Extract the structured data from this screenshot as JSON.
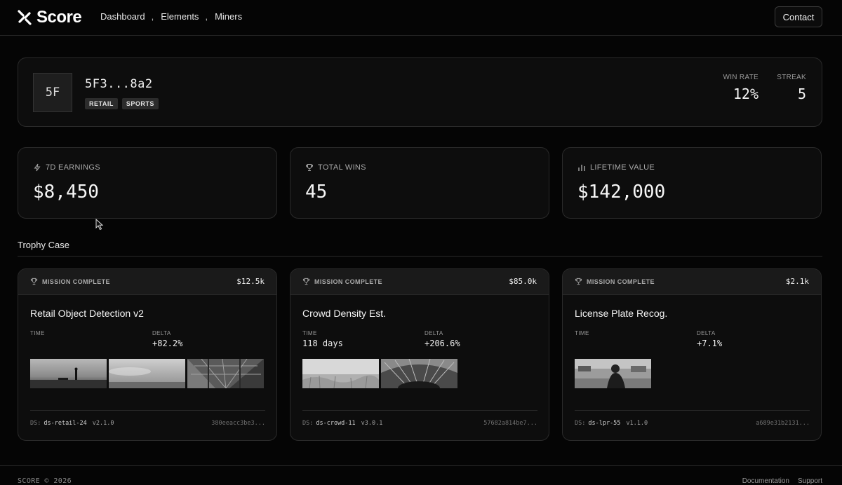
{
  "header": {
    "brand": "Score",
    "nav": [
      "Dashboard",
      "Elements",
      "Miners"
    ],
    "nav_sep": ",",
    "contact_label": "Contact"
  },
  "profile": {
    "avatar_initials": "5F",
    "id_display": "5F3...8a2",
    "tags": [
      "RETAIL",
      "SPORTS"
    ],
    "win_rate_label": "WIN RATE",
    "win_rate": "12%",
    "streak_label": "STREAK",
    "streak": "5"
  },
  "metrics": [
    {
      "icon": "lightning-icon",
      "label": "7D EARNINGS",
      "value": "$8,450"
    },
    {
      "icon": "trophy-icon",
      "label": "TOTAL WINS",
      "value": "45"
    },
    {
      "icon": "bar-chart-icon",
      "label": "LIFETIME VALUE",
      "value": "$142,000"
    }
  ],
  "trophy_case": {
    "title": "Trophy Case",
    "cards": [
      {
        "status": "MISSION COMPLETE",
        "amount": "$12.5k",
        "title": "Retail Object Detection v2",
        "time_label": "TIME",
        "time": "",
        "delta_label": "DELTA",
        "delta": "+82.2%",
        "ds_prefix": "DS:",
        "dataset": "ds-retail-24",
        "version": "v2.1.0",
        "hash": "380eeacc3be3..."
      },
      {
        "status": "MISSION COMPLETE",
        "amount": "$85.0k",
        "title": "Crowd Density Est.",
        "time_label": "TIME",
        "time": "118 days",
        "delta_label": "DELTA",
        "delta": "+206.6%",
        "ds_prefix": "DS:",
        "dataset": "ds-crowd-11",
        "version": "v3.0.1",
        "hash": "57682a814be7..."
      },
      {
        "status": "MISSION COMPLETE",
        "amount": "$2.1k",
        "title": "License Plate Recog.",
        "time_label": "TIME",
        "time": "",
        "delta_label": "DELTA",
        "delta": "+7.1%",
        "ds_prefix": "DS:",
        "dataset": "ds-lpr-55",
        "version": "v1.1.0",
        "hash": "a689e31b2131..."
      }
    ]
  },
  "footer": {
    "copyright": "SCORE © 2026",
    "links": [
      "Documentation",
      "Support"
    ]
  }
}
